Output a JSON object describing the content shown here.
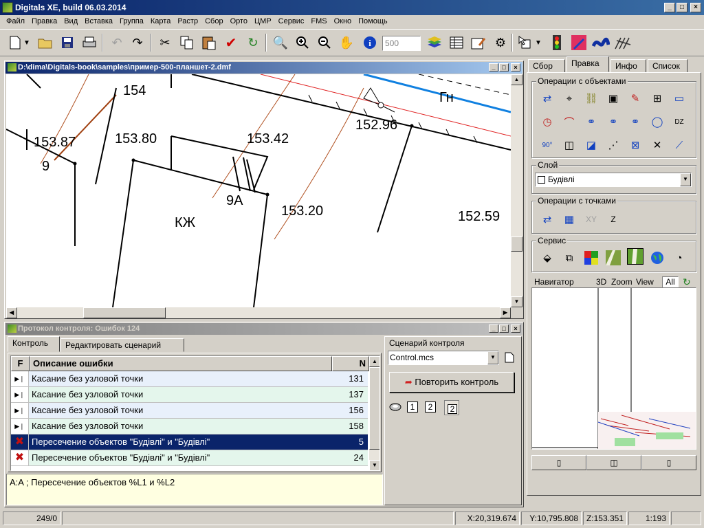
{
  "app": {
    "title": "Digitals XE, build 06.03.2014"
  },
  "menu": [
    "Файл",
    "Правка",
    "Вид",
    "Вставка",
    "Группа",
    "Карта",
    "Растр",
    "Сбор",
    "Орто",
    "ЦМР",
    "Сервис",
    "FMS",
    "Окно",
    "Помощь"
  ],
  "toolbar": {
    "scale_value": "500",
    "icons": [
      "new-file-icon",
      "open-folder-icon",
      "save-icon",
      "print-icon",
      "undo-icon",
      "redo-icon",
      "cut-icon",
      "copy-icon",
      "paste-icon",
      "check-icon",
      "refresh-icon",
      "zoom-window-icon",
      "zoom-in-icon",
      "zoom-out-icon",
      "pan-hand-icon",
      "info-icon",
      "layers-icon",
      "table-icon",
      "properties-icon",
      "settings-icon",
      "select-cursor-icon",
      "traffic-light-icon",
      "pencil-icon",
      "curve-icon",
      "snap-icon"
    ]
  },
  "map_window": {
    "title": "D:\\dima\\Digitals-book\\samples\\пример-500-планшет-2.dmf",
    "labels": [
      "153.87",
      "9",
      "153.80",
      "153.42",
      "9А",
      "153.20",
      "КЖ",
      "152.96",
      "Гн",
      "152.59",
      "154"
    ]
  },
  "protocol_window": {
    "title": "Протокол контроля: Ошибок 124",
    "tabs": [
      "Контроль",
      "Редактировать сценарий"
    ],
    "columns": {
      "f": "F",
      "desc": "Описание ошибки",
      "n": "N"
    },
    "rows": [
      {
        "status": "play",
        "desc": "Касание без узловой точки",
        "n": "131",
        "selected": false
      },
      {
        "status": "play",
        "desc": "Касание без узловой точки",
        "n": "137",
        "selected": false
      },
      {
        "status": "play",
        "desc": "Касание без узловой точки",
        "n": "156",
        "selected": false
      },
      {
        "status": "play",
        "desc": "Касание без узловой точки",
        "n": "158",
        "selected": false
      },
      {
        "status": "error",
        "desc": "Пересечение объектов \"Будівлі\" и \"Будівлі\"",
        "n": "5",
        "selected": true
      },
      {
        "status": "error",
        "desc": "Пересечение объектов \"Будівлі\" и \"Будівлі\"",
        "n": "24",
        "selected": false
      }
    ],
    "detail_text": "A:A ; Пересечение объектов %L1 и %L2",
    "scenario": {
      "label": "Сценарий контроля",
      "value": "Control.mcs",
      "repeat_button": "Повторить контроль",
      "options": [
        "1",
        "2",
        "2"
      ]
    }
  },
  "right_panel": {
    "tabs": [
      "Сбор",
      "Правка",
      "Инфо",
      "Список"
    ],
    "active_tab": "Правка",
    "object_ops": {
      "label": "Операции с объектами"
    },
    "layer": {
      "label": "Слой",
      "value": "Будівлі"
    },
    "point_ops": {
      "label": "Операции с точками",
      "xy": "XY",
      "z": "Z"
    },
    "service": {
      "label": "Сервис"
    },
    "navigator": {
      "label": "Навигатор",
      "tabs": [
        "3D",
        "Zoom",
        "View",
        "All"
      ],
      "active": "All"
    }
  },
  "status_bar": {
    "count": "249/0",
    "x": "X:20,319.674",
    "y": "Y:10,795.808",
    "z": "Z:153.351",
    "scale": "1:193"
  }
}
